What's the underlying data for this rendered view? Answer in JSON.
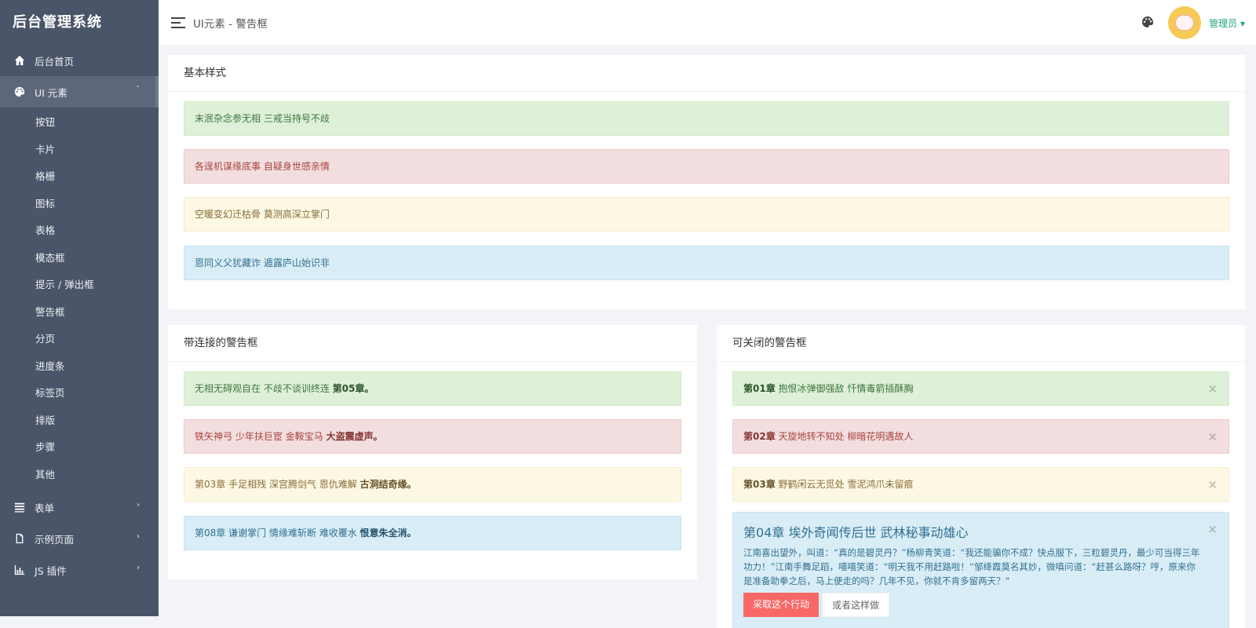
{
  "sidebar": {
    "brand": "后台管理系统",
    "home": "后台首页",
    "ui": "UI 元素",
    "sub_items": [
      "按钮",
      "卡片",
      "格栅",
      "图标",
      "表格",
      "模态框",
      "提示 / 弹出框",
      "警告框",
      "分页",
      "进度条",
      "标签页",
      "排版",
      "步骤",
      "其他"
    ],
    "forms": "表单",
    "examples": "示例页面",
    "js": "JS 插件",
    "chev_down": "ˇ",
    "chev_right": "›"
  },
  "header": {
    "title": "UI元素 - 警告框",
    "user": "管理员 ▾"
  },
  "basic": {
    "title": "基本样式",
    "alerts": [
      "末泯杂念参无相 三戒当持号不歧",
      "各逞机谋缘底事 自疑身世感亲情",
      "空暖变幻迁枯骨 莫测高深立掌门",
      "恩同义父犹藏诈 遁露庐山始识非"
    ]
  },
  "linked": {
    "title": "带连接的警告框",
    "alerts": [
      {
        "text": "无相无碍观自在 不歧不谈训终连 ",
        "link": "第05章。"
      },
      {
        "text": "铁矢神弓 少年扶巨宦 金鞍宝马 ",
        "link": "大盗震虚声。"
      },
      {
        "text": "第03章 手足相残 深宫腾剑气 恩仇难解 ",
        "link": "古洞结奇缘。"
      },
      {
        "text": "第08章 谦谢掌门 情缘难斩断 难收覆水 ",
        "link": "恨意朱全消。"
      }
    ]
  },
  "closable": {
    "title": "可关闭的警告框",
    "close": "×",
    "alerts": [
      {
        "bold": "第01章",
        "text": " 抱恨冰弹御强敌 忏情毒箭插酥胸"
      },
      {
        "bold": "第02章",
        "text": " 天旋地转不知处 柳暗花明遇故人"
      },
      {
        "bold": "第03章",
        "text": " 野鹤闲云无觅处 雪泥鸿爪未留痕"
      }
    ],
    "big": {
      "heading": "第04章 埃外奇闻传后世 武林秘事动雄心",
      "body": "江南喜出望外，叫道：“真的是碧灵丹？”杨柳青笑道：“我还能骗你不成？快点服下，三粒碧灵丹，最少可当得三年功力！”江南手舞足蹈，嘻嘻笑道：“明天我不用赶路啦！“邹绛霞莫名其妙，微嗔问道：“赶甚么路呀？哼，原来你是准备助拳之后，马上便走的吗？几年不见，你就不肯多留两天？“",
      "btn_primary": "采取这个行动",
      "btn_secondary": "或者这样做"
    }
  }
}
